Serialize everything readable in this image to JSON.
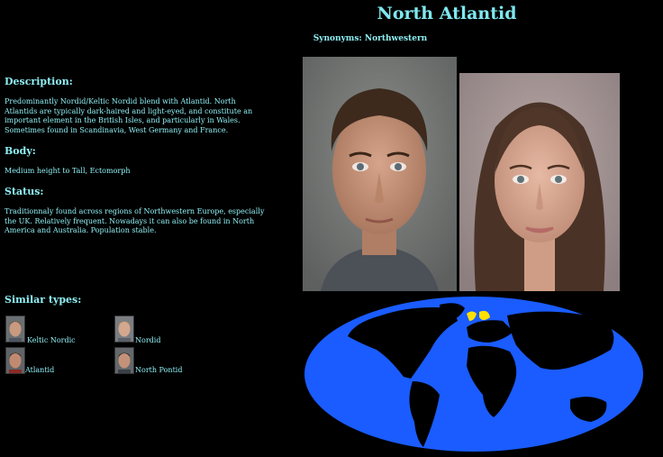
{
  "page": {
    "title": "North Atlantid",
    "synonyms": "Synonyms: Northwestern"
  },
  "description": {
    "heading": "Description:",
    "text": "Predominantly Nordid/Keltic Nordid blend with Atlantid. North Atlantids are typically dark-haired and light-eyed, and constitute an important element in the British Isles, and particularly in Wales. Sometimes found in Scandinavia, West Germany and France."
  },
  "body": {
    "heading": "Body:",
    "text": "Medium height to Tall, Ectomorph"
  },
  "status": {
    "heading": "Status:",
    "text": "Traditionnaly found across regions of Northwestern Europe, especially the UK. Relatively frequent. Nowadays it can also be found in North America and Australia. Population stable."
  },
  "similar": {
    "heading": "Similar types:",
    "types": [
      {
        "label": "Keltic Nordic"
      },
      {
        "label": "Nordid"
      },
      {
        "label": "Atlantid"
      },
      {
        "label": "North Pontid"
      }
    ]
  },
  "colors": {
    "background": "#000000",
    "text": "#8ff0f5",
    "ocean": "#1a5cff",
    "land": "#000000",
    "highlight": "#ffe000"
  }
}
